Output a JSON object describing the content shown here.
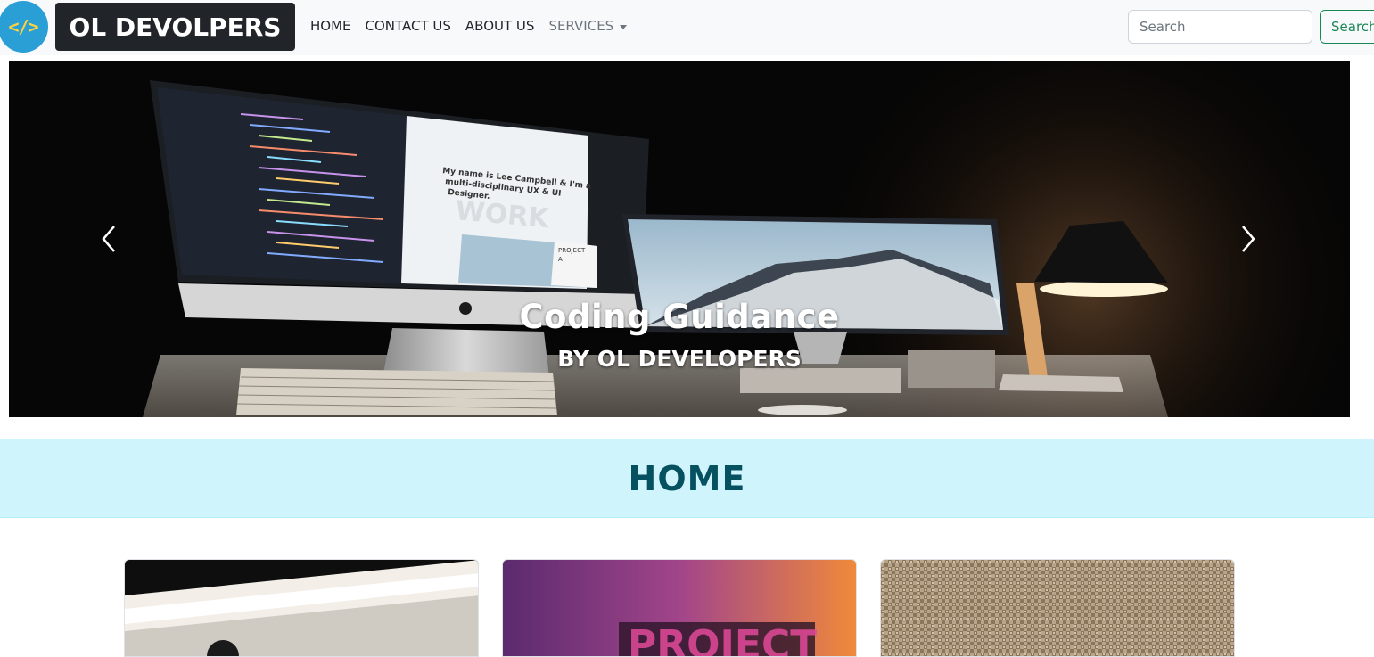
{
  "navbar": {
    "logo_glyph": "</>",
    "brand": "OL DEVOLPERS",
    "links": [
      {
        "label": "HOME"
      },
      {
        "label": "CONTACT US"
      },
      {
        "label": "ABOUT US"
      },
      {
        "label": "SERVICES"
      }
    ],
    "search": {
      "placeholder": "Search",
      "button_label": "Search"
    }
  },
  "carousel": {
    "title": "Coding Guidance",
    "subtitle": "BY OL DEVELOPERS",
    "screen_text": "My name is Lee Campbell & I'm a multi-disciplinary UX & UI Designer.",
    "screen_bg_word": "WORK",
    "screen_card_label": "PROJECT A"
  },
  "section": {
    "title": "HOME"
  },
  "colors": {
    "navbar_bg": "#f8f9fa",
    "brand_bg": "#212529",
    "search_green": "#198754",
    "banner_bg": "#cff4fc",
    "banner_text": "#055160",
    "logo_blue": "#2a9fd6"
  },
  "icons": [
    "code-logo-icon",
    "chevron-left-icon",
    "chevron-right-icon",
    "caret-down-icon"
  ]
}
